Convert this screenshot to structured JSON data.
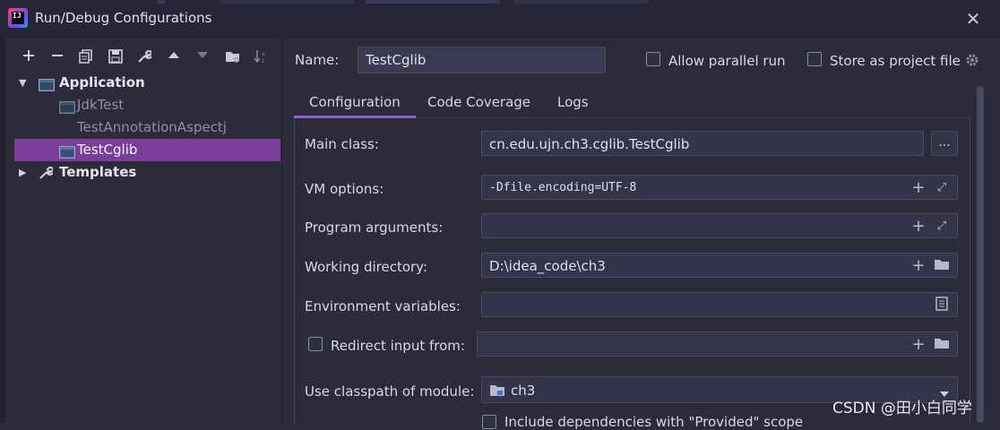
{
  "window": {
    "title": "Run/Debug Configurations",
    "close_icon": "close-icon"
  },
  "toolbar": {
    "icons": [
      "add-icon",
      "remove-icon",
      "copy-icon",
      "save-icon",
      "wrench-icon",
      "move-up-icon",
      "move-down-icon",
      "folder-add-icon",
      "sort-icon"
    ]
  },
  "tree": {
    "application": "Application",
    "items": [
      "JdkTest",
      "TestAnnotationAspectj",
      "TestCglib"
    ],
    "selected": "TestCglib",
    "templates": "Templates"
  },
  "form": {
    "name_label": "Name:",
    "name_value": "TestCglib",
    "allow_parallel": "Allow parallel run",
    "store_project": "Store as project file",
    "tabs": [
      "Configuration",
      "Code Coverage",
      "Logs"
    ],
    "main_class_label": "Main class:",
    "main_class_value": "cn.edu.ujn.ch3.cglib.TestCglib",
    "browse_label": "...",
    "vm_label": "VM options:",
    "vm_value": "-Dfile.encoding=UTF-8",
    "args_label": "Program arguments:",
    "args_value": "",
    "workdir_label": "Working directory:",
    "workdir_value": "D:\\idea_code\\ch3",
    "env_label": "Environment variables:",
    "env_value": "",
    "redirect_label": "Redirect input from:",
    "module_label": "Use classpath of module:",
    "module_value": "ch3",
    "include_deps": "Include dependencies with \"Provided\" scope"
  },
  "watermark": "CSDN @田小白同学",
  "colors": {
    "background": "#2b2b3a",
    "selection": "#7a3d9a",
    "tab_accent": "#8d5fd3"
  }
}
